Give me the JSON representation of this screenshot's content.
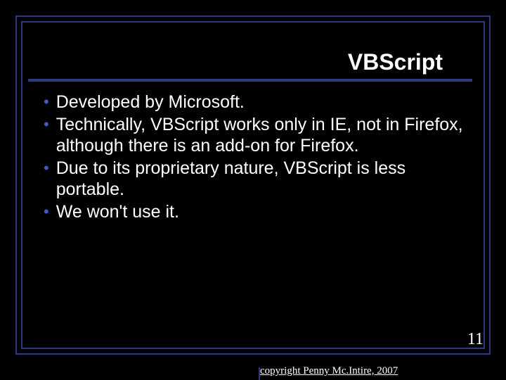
{
  "title": "VBScript",
  "bullets": [
    "Developed by Microsoft.",
    "Technically, VBScript works only in IE, not in Firefox, although there is an add-on for Firefox.",
    "Due to its proprietary nature, VBScript is less portable.",
    "We won't use it."
  ],
  "page_number": "11",
  "copyright": "copyright Penny Mc.Intire, 2007"
}
